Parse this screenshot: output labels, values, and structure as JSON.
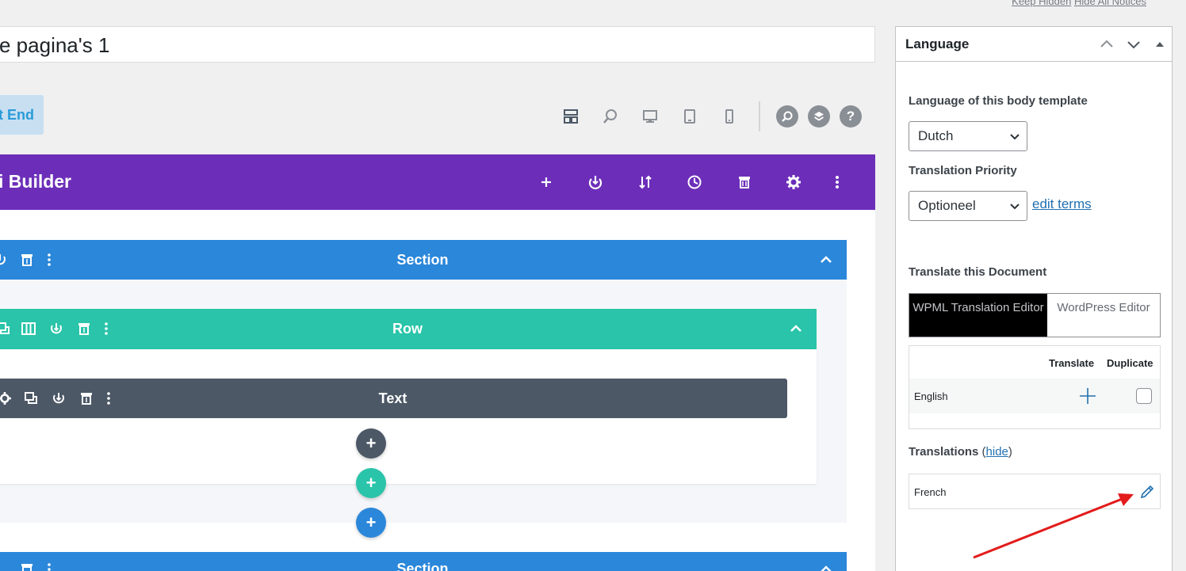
{
  "notices": {
    "keep_hidden": "Keep Hidden",
    "hide_all": "Hide All Notices"
  },
  "page_title": "e pagina's 1",
  "frontend_button": "t End",
  "builder": {
    "title": "i Builder"
  },
  "modules": {
    "section": "Section",
    "row": "Row",
    "text": "Text",
    "section2": "Section"
  },
  "colors": {
    "builder_bar": "#6c2eb9",
    "section": "#2b87da",
    "row": "#29c4a9",
    "text_module": "#4c5866",
    "link": "#2271b1",
    "annotation_arrow": "#e31b1b"
  },
  "view_icons": [
    "wireframe-icon",
    "zoom-icon",
    "desktop-icon",
    "tablet-icon",
    "phone-icon"
  ],
  "circle_icons": [
    "search-icon",
    "layers-icon",
    "help-icon"
  ],
  "help_glyph": "?",
  "add_glyph": "+",
  "language_panel": {
    "title": "Language",
    "lang_label": "Language of this body template",
    "lang_value": "Dutch",
    "priority_label": "Translation Priority",
    "priority_value": "Optioneel",
    "edit_terms": "edit terms",
    "translate_doc_label": "Translate this Document",
    "tab_wpml": "WPML Translation Editor",
    "tab_wp": "WordPress Editor",
    "col_translate": "Translate",
    "col_duplicate": "Duplicate",
    "source_lang": "English",
    "translations_label": "Translations",
    "hide_link": "hide",
    "paren_open": " (",
    "paren_close": ")",
    "translated_lang": "French"
  }
}
